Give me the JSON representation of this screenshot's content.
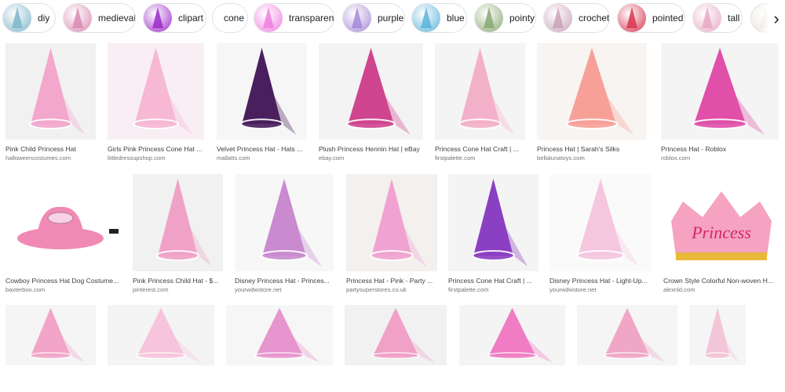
{
  "chips": [
    {
      "label": "diy",
      "color": "#7fb6c9"
    },
    {
      "label": "medieval",
      "color": "#d98ab2"
    },
    {
      "label": "clipart",
      "color": "#9c2ac9"
    },
    {
      "label": "cone",
      "color": ""
    },
    {
      "label": "transparent",
      "color": "#f07ee0"
    },
    {
      "label": "purple",
      "color": "#a68ad6"
    },
    {
      "label": "blue",
      "color": "#5db3d9"
    },
    {
      "label": "pointy",
      "color": "#8aa873"
    },
    {
      "label": "crochet",
      "color": "#c9a3b8"
    },
    {
      "label": "pointed",
      "color": "#d8344f"
    },
    {
      "label": "tall",
      "color": "#e7a9c4"
    },
    {
      "label": "",
      "color": "#e9e3d6"
    }
  ],
  "scroll_icon": "chevron-right-icon",
  "results": [
    {
      "title": "Pink Child Princess Hat",
      "source": "halloweencostumes.com",
      "bg": "#f1f1f1",
      "hat": "#f3a7cd"
    },
    {
      "title": "Girls Pink Princess Cone Hat ...",
      "source": "littledressupshop.com",
      "bg": "#f8eef3",
      "hat": "#f6b8d3"
    },
    {
      "title": "Velvet Princess Hat - Hats ...",
      "source": "mallatts.com",
      "bg": "#f6f6f6",
      "hat": "#4a1f5e"
    },
    {
      "title": "Plush Princess Hennin Hat | eBay",
      "source": "ebay.com",
      "bg": "#f3f3f3",
      "hat": "#d0458f"
    },
    {
      "title": "Princess Cone Hat Craft | ...",
      "source": "firstpalette.com",
      "bg": "#f4f4f4",
      "hat": "#f3b1c9"
    },
    {
      "title": "Princess Hat | Sarah's Silks",
      "source": "bellalunatoys.com",
      "bg": "#f7f4f2",
      "hat": "#f7a097"
    },
    {
      "title": "Princess Hat - Roblox",
      "source": "roblox.com",
      "bg": "#f4f4f4",
      "hat": "#e04fa8"
    },
    {
      "title": "Cowboy Princess Hat Dog Costume...",
      "source": "baxterboo.com",
      "bg": "#ffffff",
      "hat": "#f08ab4"
    },
    {
      "title": "Pink Princess Child Hat - $...",
      "source": "pinterest.com",
      "bg": "#f1f1f1",
      "hat": "#f0a1c7"
    },
    {
      "title": "Disney Princess Hat - Princes...",
      "source": "yourwdwstore.net",
      "bg": "#f7f7f7",
      "hat": "#c98ad0"
    },
    {
      "title": "Princess Hat - Pink - Party ...",
      "source": "partysuperstores.co.uk",
      "bg": "#f3f0ee",
      "hat": "#f0a3d0"
    },
    {
      "title": "Princess Cone Hat Craft | ...",
      "source": "firstpalette.com",
      "bg": "#f4f4f4",
      "hat": "#8b3fc2"
    },
    {
      "title": "Disney Princess Hat - Light-Up...",
      "source": "yourwdwstore.net",
      "bg": "#fafafa",
      "hat": "#f4c7df"
    },
    {
      "title": "Crown Style Colorful Non-woven H...",
      "source": "alexnld.com",
      "bg": "#ffffff",
      "hat": "#f5a3c0"
    },
    {
      "title": "",
      "source": "",
      "bg": "#f5f5f5",
      "hat": "#f2a5c8"
    },
    {
      "title": "",
      "source": "",
      "bg": "#f4f4f4",
      "hat": "#f7c4dd"
    },
    {
      "title": "",
      "source": "",
      "bg": "#f6f6f6",
      "hat": "#e795cf"
    },
    {
      "title": "",
      "source": "",
      "bg": "#f1f1f1",
      "hat": "#f1a0c8"
    },
    {
      "title": "",
      "source": "",
      "bg": "#f4f4f4",
      "hat": "#f07cc3"
    },
    {
      "title": "",
      "source": "",
      "bg": "#f5f5f5",
      "hat": "#f0a7c6"
    },
    {
      "title": "",
      "source": "",
      "bg": "#f5f5f5",
      "hat": "#f2c6d8"
    }
  ],
  "crown_text": "Princess"
}
